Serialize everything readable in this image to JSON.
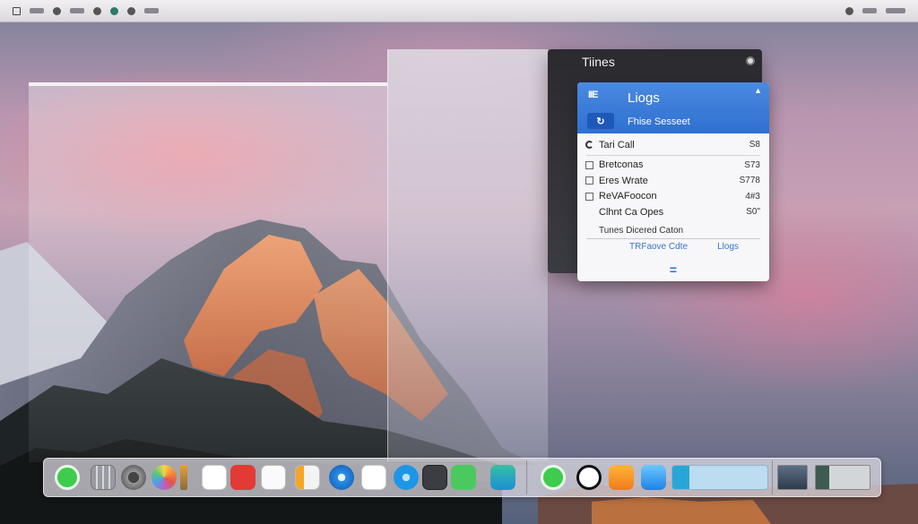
{
  "desktop": {
    "wallpaper": "mountain-sunset-wallpaper"
  },
  "dark_window": {
    "title": "Tiines"
  },
  "logs_panel": {
    "header_icon_text": "IIE",
    "title": "Liogs",
    "subtitle": "Fhise Sesseet",
    "rows": [
      {
        "label": "Tari Call",
        "value": "S8"
      },
      {
        "label": "Bretconas",
        "value": "S73"
      },
      {
        "label": "Eres Wrate",
        "value": "S778"
      },
      {
        "label": "ReVAFoocon",
        "value": "4#3"
      },
      {
        "label": "Clhnt Ca Opes",
        "value": "S0\""
      }
    ],
    "footer_caption": "Tunes Dicered Caton",
    "footer_links": [
      "TRFaove Cdte",
      "Llogs"
    ],
    "footer_icon": "="
  },
  "dock": {
    "icons": [
      "messages-icon",
      "launchpad-icon",
      "system-preferences-icon",
      "photos-icon",
      "pinwheel-icon",
      "app-store-icon",
      "red-app-icon",
      "text-editor-icon",
      "spreadsheet-icon",
      "safari-compass-icon",
      "blank-document-icon",
      "safari-icon",
      "calculator-icon",
      "facetime-icon",
      "maps-icon",
      "messages-icon-2",
      "clock-icon",
      "pages-icon",
      "mail-icon",
      "finder-window-icon",
      "photo-thumbnail-icon",
      "preview-window-icon"
    ]
  },
  "colors": {
    "accent": "#2f6fd0",
    "dock_bg": "#e1dee6",
    "dark_window": "#2a2a2f"
  }
}
